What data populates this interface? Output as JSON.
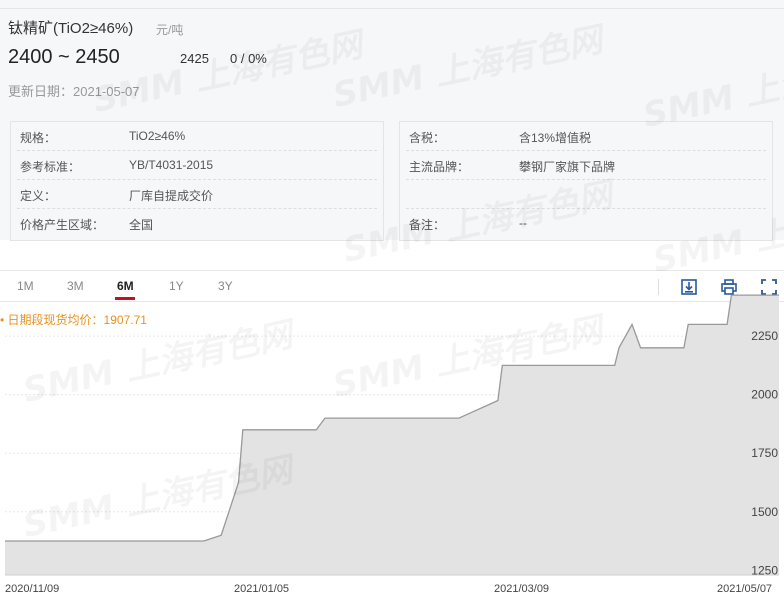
{
  "header": {
    "title": "钛精矿(TiO2≥46%)",
    "unit": "元/吨",
    "price_range": "2400 ~ 2450",
    "average": "2425",
    "change": "0 / 0%",
    "update_date": "更新日期：2021-05-07"
  },
  "info": {
    "left": [
      {
        "label": "规格：",
        "value": "TiO2≥46%"
      },
      {
        "label": "参考标准：",
        "value": "YB/T4031-2015"
      },
      {
        "label": "定义：",
        "value": "厂库自提成交价"
      },
      {
        "label": "价格产生区域：",
        "value": "全国"
      }
    ],
    "right": [
      {
        "label": "含税：",
        "value": "含13%增值税"
      },
      {
        "label": "主流品牌：",
        "value": "攀钢厂家旗下品牌"
      },
      {
        "label": "",
        "value": ""
      },
      {
        "label": "备注：",
        "value": "--"
      }
    ]
  },
  "tabs": [
    "1M",
    "3M",
    "6M",
    "1Y",
    "3Y"
  ],
  "active_tab": "6M",
  "tools": [
    "download-icon",
    "print-icon",
    "fullscreen-icon"
  ],
  "watermark": "SMM 上海有色网",
  "colors": {
    "accent": "#c0102a",
    "legend": "#e8911d",
    "line": "#999999",
    "area": "#e3e3e3"
  },
  "chart_data": {
    "type": "area",
    "title": "",
    "legend": "日期段现货均价：1907.71",
    "x_tick_labels": [
      "2020/11/09",
      "2021/01/05",
      "2021/03/09",
      "2021/05/07"
    ],
    "x_range": [
      "2020/11/09",
      "2021/05/07"
    ],
    "ylim": [
      1230,
      2400
    ],
    "y_ticks": [
      1250,
      1500,
      1750,
      2000,
      2250
    ],
    "grid": true,
    "series": [
      {
        "points": [
          [
            "2020-11-09",
            1375
          ],
          [
            "2020-11-25",
            1375
          ],
          [
            "2020-12-10",
            1375
          ],
          [
            "2020-12-25",
            1375
          ],
          [
            "2020-12-29",
            1400
          ],
          [
            "2021-01-02",
            1625
          ],
          [
            "2021-01-03",
            1850
          ],
          [
            "2021-01-20",
            1850
          ],
          [
            "2021-01-21",
            1875
          ],
          [
            "2021-01-22",
            1900
          ],
          [
            "2021-02-10",
            1900
          ],
          [
            "2021-02-22",
            1900
          ],
          [
            "2021-02-25",
            1925
          ],
          [
            "2021-02-28",
            1950
          ],
          [
            "2021-03-03",
            1975
          ],
          [
            "2021-03-04",
            2125
          ],
          [
            "2021-03-30",
            2125
          ],
          [
            "2021-03-31",
            2200
          ],
          [
            "2021-04-03",
            2300
          ],
          [
            "2021-04-05",
            2200
          ],
          [
            "2021-04-15",
            2200
          ],
          [
            "2021-04-16",
            2300
          ],
          [
            "2021-04-25",
            2300
          ],
          [
            "2021-04-26",
            2425
          ],
          [
            "2021-05-07",
            2425
          ]
        ]
      }
    ]
  }
}
